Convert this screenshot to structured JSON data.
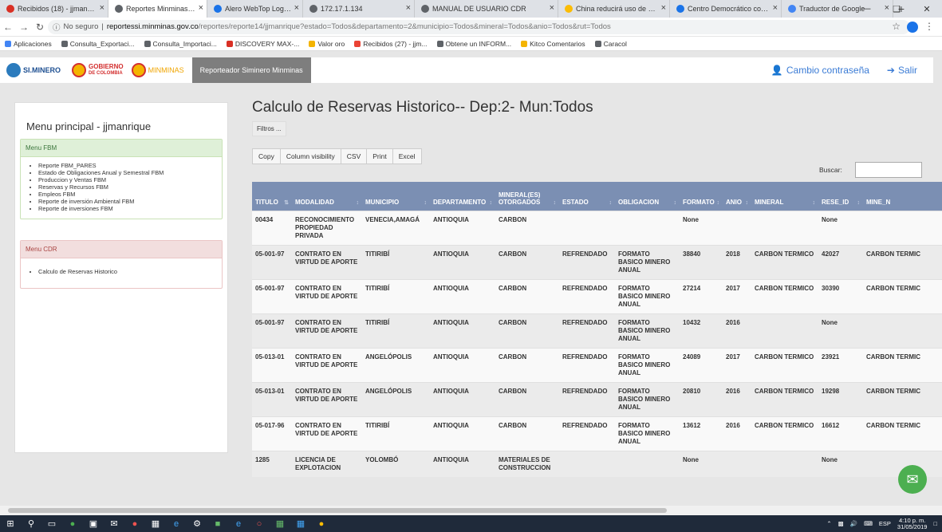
{
  "browser": {
    "tabs": [
      {
        "label": "Recibidos (18) - jjmanrique",
        "color": "#d93025",
        "active": false
      },
      {
        "label": "Reportes Minminas - Calcul",
        "color": "#5f6368",
        "active": true
      },
      {
        "label": "Alero WebTop Logon",
        "color": "#1a73e8",
        "active": false
      },
      {
        "label": "172.17.1.134",
        "color": "#5f6368",
        "active": false
      },
      {
        "label": "MANUAL DE USUARIO CDR",
        "color": "#5f6368",
        "active": false
      },
      {
        "label": "China reducirá uso de carbó",
        "color": "#fbbc04",
        "active": false
      },
      {
        "label": "Centro Democrático coava",
        "color": "#1a73e8",
        "active": false
      },
      {
        "label": "Traductor de Google",
        "color": "#4285f4",
        "active": false
      }
    ],
    "security": "No seguro",
    "url_domain": "reportessi.minminas.gov.co",
    "url_path": "/reportes/reporte14/jjmanrique?estado=Todos&departamento=2&municipio=Todos&mineral=Todos&anio=Todos&rut=Todos",
    "bookmarks": [
      {
        "label": "Aplicaciones",
        "color": "#4285f4"
      },
      {
        "label": "Consulta_Exportaci...",
        "color": "#5f6368"
      },
      {
        "label": "Consulta_Importaci...",
        "color": "#5f6368"
      },
      {
        "label": "DISCOVERY MAX-...",
        "color": "#d93025"
      },
      {
        "label": "Valor oro",
        "color": "#f4b400"
      },
      {
        "label": "Recibidos (27) - jjm...",
        "color": "#ea4335"
      },
      {
        "label": "Obtene un INFORM...",
        "color": "#5f6368"
      },
      {
        "label": "Kitco Comentarios",
        "color": "#f4b400"
      },
      {
        "label": "Caracol",
        "color": "#5f6368"
      }
    ]
  },
  "app": {
    "logo_simminero": "SI.MINERO",
    "logo_gobierno_1": "GOBIERNO",
    "logo_gobierno_2": "DE COLOMBIA",
    "logo_minminas": "MINMINAS",
    "nav_item": "Reporteador Siminero Minminas",
    "change_password": "Cambio contraseña",
    "logout": "Salir"
  },
  "sidebar": {
    "title": "Menu principal - jjmanrique",
    "fbm": {
      "header": "Menu FBM",
      "items": [
        "Reporte FBM_PARES",
        "Estado de Obligaciones Anual y Semestral FBM",
        "Produccion y Ventas FBM",
        "Reservas y Recursos FBM",
        "Empleos FBM",
        "Reporte de inversión Ambiental FBM",
        "Reporte de inversiones FBM"
      ]
    },
    "cdr": {
      "header": "Menu CDR",
      "items": [
        "Calculo de Reservas Historico"
      ]
    }
  },
  "main": {
    "title": "Calculo de Reservas Historico-- Dep:2- Mun:Todos",
    "filters": "Filtros ...",
    "buttons": [
      "Copy",
      "Column visibility",
      "CSV",
      "Print",
      "Excel"
    ],
    "search_label": "Buscar:",
    "columns": [
      "TITULO",
      "MODALIDAD",
      "MUNICIPIO",
      "DEPARTAMENTO",
      "MINERAL(ES) OTORGADOS",
      "ESTADO",
      "OBLIGACION",
      "FORMATO",
      "ANIO",
      "MINERAL",
      "RESE_ID",
      "MINE_N"
    ],
    "rows": [
      [
        "00434",
        "RECONOCIMIENTO PROPIEDAD PRIVADA",
        "VENECIA,AMAGÁ",
        "ANTIOQUIA",
        "CARBON",
        "",
        "",
        "None",
        "",
        "",
        "None",
        ""
      ],
      [
        "05-001-97",
        "CONTRATO EN VIRTUD DE APORTE",
        "TITIRIBÍ",
        "ANTIOQUIA",
        "CARBON",
        "REFRENDADO",
        "FORMATO BASICO MINERO ANUAL",
        "38840",
        "2018",
        "CARBON TERMICO",
        "42027",
        "CARBON TERMIC"
      ],
      [
        "05-001-97",
        "CONTRATO EN VIRTUD DE APORTE",
        "TITIRIBÍ",
        "ANTIOQUIA",
        "CARBON",
        "REFRENDADO",
        "FORMATO BASICO MINERO ANUAL",
        "27214",
        "2017",
        "CARBON TERMICO",
        "30390",
        "CARBON TERMIC"
      ],
      [
        "05-001-97",
        "CONTRATO EN VIRTUD DE APORTE",
        "TITIRIBÍ",
        "ANTIOQUIA",
        "CARBON",
        "REFRENDADO",
        "FORMATO BASICO MINERO ANUAL",
        "10432",
        "2016",
        "",
        "None",
        ""
      ],
      [
        "05-013-01",
        "CONTRATO EN VIRTUD DE APORTE",
        "ANGELÓPOLIS",
        "ANTIOQUIA",
        "CARBON",
        "REFRENDADO",
        "FORMATO BASICO MINERO ANUAL",
        "24089",
        "2017",
        "CARBON TERMICO",
        "23921",
        "CARBON TERMIC"
      ],
      [
        "05-013-01",
        "CONTRATO EN VIRTUD DE APORTE",
        "ANGELÓPOLIS",
        "ANTIOQUIA",
        "CARBON",
        "REFRENDADO",
        "FORMATO BASICO MINERO ANUAL",
        "20810",
        "2016",
        "CARBON TERMICO",
        "19298",
        "CARBON TERMIC"
      ],
      [
        "05-017-96",
        "CONTRATO EN VIRTUD DE APORTE",
        "TITIRIBÍ",
        "ANTIOQUIA",
        "CARBON",
        "REFRENDADO",
        "FORMATO BASICO MINERO ANUAL",
        "13612",
        "2016",
        "CARBON TERMICO",
        "16612",
        "CARBON TERMIC"
      ],
      [
        "1285",
        "LICENCIA DE EXPLOTACION",
        "YOLOMBÓ",
        "ANTIOQUIA",
        "MATERIALES DE CONSTRUCCION",
        "",
        "",
        "None",
        "",
        "",
        "None",
        ""
      ]
    ]
  },
  "taskbar": {
    "lang": "ESP",
    "time": "4:10 p. m.",
    "date": "31/05/2019"
  }
}
